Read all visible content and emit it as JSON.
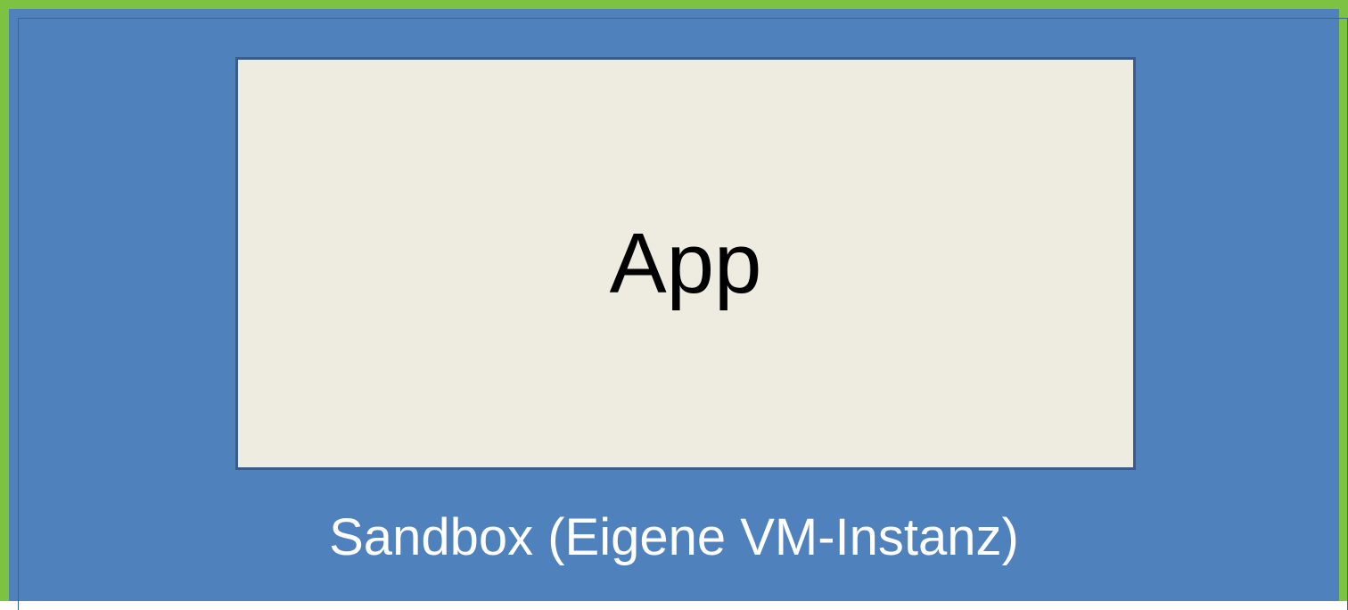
{
  "diagram": {
    "app": {
      "label": "App"
    },
    "sandbox": {
      "label": "Sandbox (Eigene VM-Instanz)"
    }
  },
  "colors": {
    "sandbox_fill": "#4f81bd",
    "outer_border": "#7ec242",
    "app_fill": "#eeece1",
    "app_border": "#385d8a",
    "app_text": "#000000",
    "sandbox_text": "#ffffff"
  }
}
